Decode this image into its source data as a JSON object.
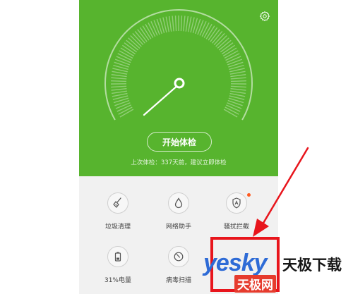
{
  "hero": {
    "start_label": "开始体检",
    "last_check": "上次体检：337天前，建议立即体检",
    "settings_icon": "gear-icon"
  },
  "tools": [
    {
      "label": "垃圾清理",
      "icon": "broom-icon",
      "badge": false
    },
    {
      "label": "网络助手",
      "icon": "drop-icon",
      "badge": false
    },
    {
      "label": "骚扰拦截",
      "icon": "shield-icon",
      "badge": true
    },
    {
      "label": "31%电量",
      "icon": "battery-icon",
      "badge": false
    },
    {
      "label": "病毒扫描",
      "icon": "scan-icon",
      "badge": false
    }
  ],
  "watermark": {
    "brand": "yesky",
    "name_cn": "天极下载",
    "sub": "天极网"
  },
  "colors": {
    "hero_green": "#57b42e",
    "panel_bg": "#f1f1f1",
    "annotation_red": "#e8151c",
    "brand_blue": "#2e6bd6"
  }
}
